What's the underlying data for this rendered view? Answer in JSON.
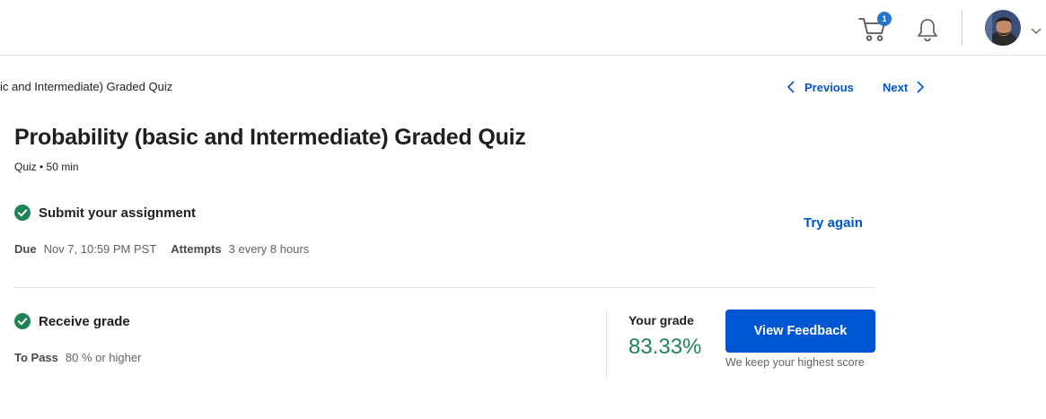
{
  "header": {
    "cart_count": "1",
    "icons": [
      "cart-icon",
      "bell-icon",
      "avatar",
      "chevron-down-icon"
    ]
  },
  "breadcrumb": {
    "text": "ic and Intermediate) Graded Quiz"
  },
  "nav": {
    "previous_label": "Previous",
    "next_label": "Next"
  },
  "quiz": {
    "title": "Probability (basic and Intermediate) Graded Quiz",
    "subtitle": "Quiz • 50 min"
  },
  "submit": {
    "heading": "Submit your assignment",
    "due_label": "Due",
    "due_value": "Nov 7, 10:59 PM PST",
    "attempts_label": "Attempts",
    "attempts_value": "3 every 8 hours",
    "try_again_label": "Try again"
  },
  "grade": {
    "heading": "Receive grade",
    "to_pass_label": "To Pass",
    "to_pass_value": "80 % or higher",
    "your_grade_label": "Your grade",
    "your_grade_value": "83.33%",
    "feedback_button_label": "View Feedback",
    "keep_note": "We keep your highest score"
  },
  "colors": {
    "accent": "#0056d2",
    "success": "#1f8354",
    "badge": "#2a73cc"
  }
}
